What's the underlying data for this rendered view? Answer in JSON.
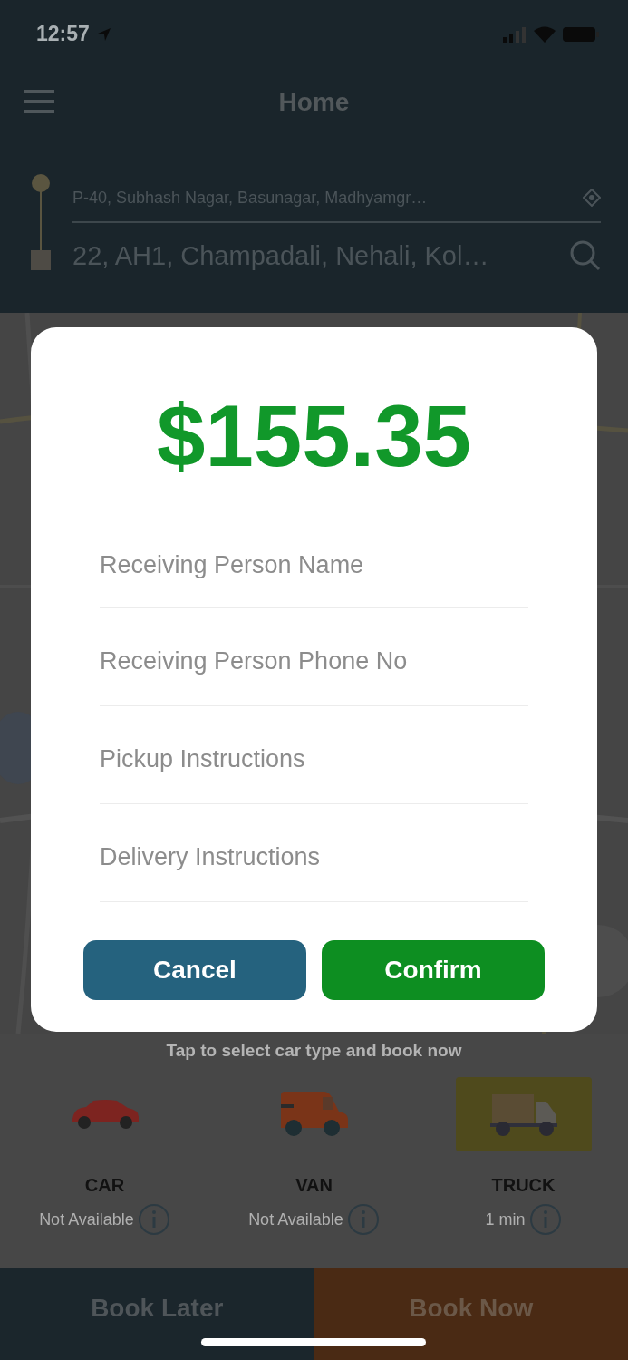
{
  "status_bar": {
    "time": "12:57"
  },
  "header": {
    "title": "Home"
  },
  "route": {
    "pickup": "P-40, Subhash Nagar, Basunagar, Madhyamgr…",
    "dropoff": "22, AH1, Champadali, Nehali, Kol…"
  },
  "dialog": {
    "price": "$155.35",
    "fields": [
      {
        "placeholder": "Receiving Person Name"
      },
      {
        "placeholder": "Receiving Person Phone No"
      },
      {
        "placeholder": "Pickup Instructions"
      },
      {
        "placeholder": "Delivery Instructions"
      }
    ],
    "buttons": [
      {
        "kind": "cancel",
        "label": "Cancel"
      },
      {
        "kind": "confirm",
        "label": "Confirm"
      }
    ]
  },
  "vehicles": {
    "hint": "Tap to select car type and book now",
    "items": [
      {
        "kind": "car",
        "name": "CAR",
        "eta": "Not Available",
        "selected": false
      },
      {
        "kind": "van",
        "name": "VAN",
        "eta": "Not Available",
        "selected": false
      },
      {
        "kind": "truck",
        "name": "TRUCK",
        "eta": "1 min",
        "selected": true
      }
    ]
  },
  "footer": {
    "buttons": [
      {
        "kind": "later",
        "label": "Book Later"
      },
      {
        "kind": "now",
        "label": "Book Now"
      }
    ]
  }
}
